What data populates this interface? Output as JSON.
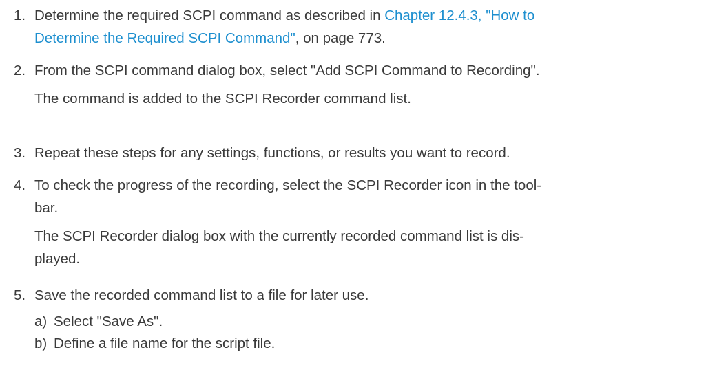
{
  "steps": [
    {
      "number": "1.",
      "link_line1": "Chapter 12.4.3, \"How to",
      "link_line2": "Determine the Required SCPI Command\"",
      "text_after_link": ", on page 773."
    },
    {
      "number": "2.",
      "text": "From the SCPI command dialog box, select \"Add SCPI Command to Recording\".",
      "result": "The command is added to the SCPI Recorder command list."
    },
    {
      "number": "3.",
      "text": "Repeat these steps for any settings, functions, or results you want to record."
    },
    {
      "number": "4.",
      "line1": "To check the progress of the recording, select the SCPI Recorder icon in the tool-",
      "line2": "bar.",
      "result_line1": "The SCPI Recorder dialog box with the currently recorded command list is dis-",
      "result_line2": "played."
    },
    {
      "number": "5.",
      "text": "Save the recorded command list to a file for later use.",
      "substeps": [
        {
          "label": "a)",
          "text": "Select \"Save As\"."
        },
        {
          "label": "b)",
          "text": "Define a file name for the script file."
        }
      ]
    }
  ],
  "step1_prefix": "Determine the required SCPI command as described in "
}
